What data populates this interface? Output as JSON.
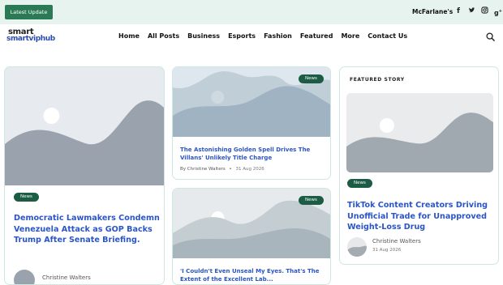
{
  "topbar": {
    "latest_label": "Latest Update",
    "ticker_text": "McFarlane's",
    "social_icons": [
      "facebook-icon",
      "twitter-icon",
      "instagram-icon",
      "google-plus-icon"
    ]
  },
  "logo": {
    "line1": "smart",
    "line2": "smartviphub"
  },
  "nav": {
    "items": [
      {
        "label": "Home"
      },
      {
        "label": "All Posts"
      },
      {
        "label": "Business"
      },
      {
        "label": "Esports"
      },
      {
        "label": "Fashion"
      },
      {
        "label": "Featured"
      },
      {
        "label": "More"
      },
      {
        "label": "Contact Us"
      }
    ]
  },
  "posts": {
    "main": {
      "badge": "News",
      "title": "Democratic Lawmakers Condemn Venezuela Attack as GOP Backs Trump After Senate Briefing.",
      "author": "Christine Walters"
    },
    "card2": {
      "badge": "News",
      "title": "The Astonishing Golden Spell Drives The Villans' Unlikely Title Charge",
      "author": "By Christine Walters",
      "date": "31 Aug 2026"
    },
    "card3": {
      "badge": "News",
      "title": "'I Couldn't Even Unseal My Eyes. That's The Extent of the Excellent Lab..."
    }
  },
  "featured": {
    "label": "FEATURED STORY",
    "badge": "News",
    "title": "TikTok Content Creators Driving Unofficial Trade for Unapproved Weight-Loss Drug",
    "author": "Christine Walters",
    "date": "31 Aug 2026"
  },
  "colors": {
    "accent_dark": "#1c5c44",
    "link": "#2a55c8",
    "topbar_bg": "#e7f3ee",
    "card_border": "#cde8e0"
  }
}
